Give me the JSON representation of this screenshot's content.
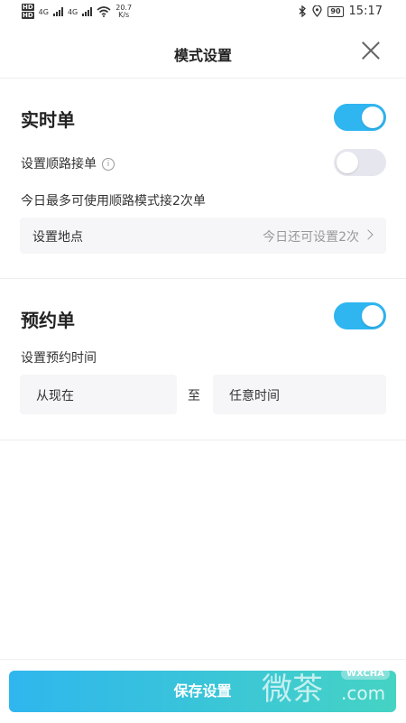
{
  "status_bar": {
    "hd1": "HD",
    "hd2": "HD",
    "net1": "4G",
    "net2": "4G",
    "speed_value": "20.7",
    "speed_unit": "K/s",
    "battery": "90",
    "time": "15:17"
  },
  "nav": {
    "title": "模式设置"
  },
  "realtime": {
    "title": "实时单",
    "toggle_on": true,
    "route_label": "设置顺路接单",
    "route_toggle_on": false,
    "limit_note": "今日最多可使用顺路模式接2次单",
    "location_label": "设置地点",
    "location_remaining": "今日还可设置2次"
  },
  "reservation": {
    "title": "预约单",
    "toggle_on": true,
    "time_label": "设置预约时间",
    "from": "从现在",
    "to_label": "至",
    "to": "任意时间"
  },
  "footer": {
    "save_label": "保存设置"
  },
  "watermark": {
    "text": "微茶",
    "badge": "WXCHA",
    "domain": ".com"
  },
  "colors": {
    "accent": "#2fb5f0",
    "button_gradient_end": "#45d3c4"
  }
}
